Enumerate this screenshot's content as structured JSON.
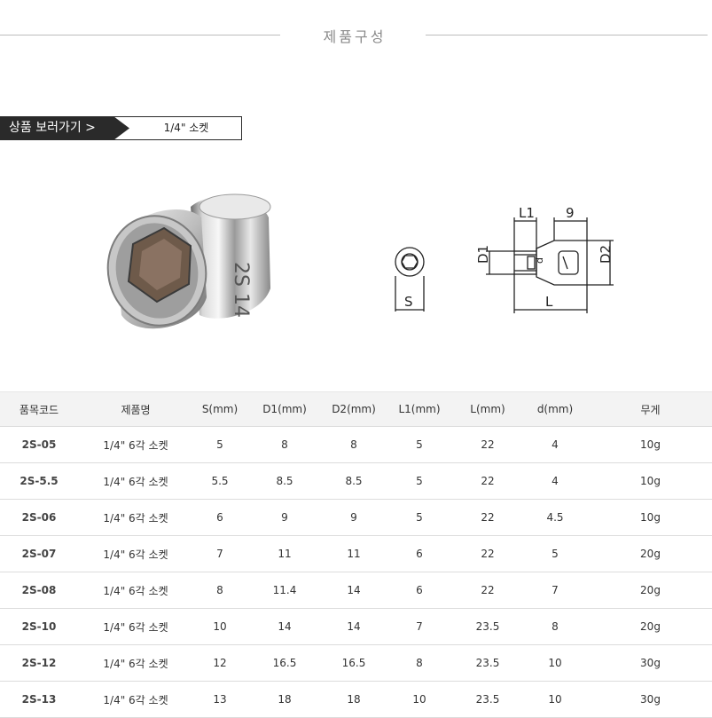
{
  "heading": {
    "title": "제품구성"
  },
  "banner": {
    "link_label": "상품 보러가기 >",
    "product": "1/4\" 소켓"
  },
  "diagram": {
    "L1": "L1",
    "nine": "9",
    "D1": "D1",
    "D2": "D2",
    "d": "d",
    "L": "L",
    "S": "S"
  },
  "table": {
    "headers": [
      "품목코드",
      "제품명",
      "S(mm)",
      "D1(mm)",
      "D2(mm)",
      "L1(mm)",
      "L(mm)",
      "d(mm)",
      "무게"
    ],
    "rows": [
      [
        "2S-05",
        "1/4\" 6각 소켓",
        "5",
        "8",
        "8",
        "5",
        "22",
        "4",
        "10g"
      ],
      [
        "2S-5.5",
        "1/4\" 6각 소켓",
        "5.5",
        "8.5",
        "8.5",
        "5",
        "22",
        "4",
        "10g"
      ],
      [
        "2S-06",
        "1/4\" 6각 소켓",
        "6",
        "9",
        "9",
        "5",
        "22",
        "4.5",
        "10g"
      ],
      [
        "2S-07",
        "1/4\" 6각 소켓",
        "7",
        "11",
        "11",
        "6",
        "22",
        "5",
        "20g"
      ],
      [
        "2S-08",
        "1/4\" 6각 소켓",
        "8",
        "11.4",
        "14",
        "6",
        "22",
        "7",
        "20g"
      ],
      [
        "2S-10",
        "1/4\" 6각 소켓",
        "10",
        "14",
        "14",
        "7",
        "23.5",
        "8",
        "20g"
      ],
      [
        "2S-12",
        "1/4\" 6각 소켓",
        "12",
        "16.5",
        "16.5",
        "8",
        "23.5",
        "10",
        "30g"
      ],
      [
        "2S-13",
        "1/4\" 6각 소켓",
        "13",
        "18",
        "18",
        "10",
        "23.5",
        "10",
        "30g"
      ]
    ]
  }
}
